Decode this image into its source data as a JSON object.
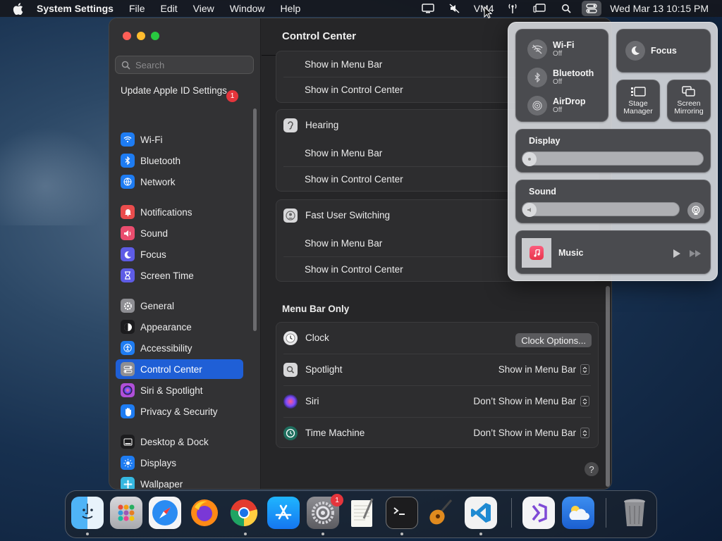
{
  "menubar": {
    "app_name": "System Settings",
    "menus": [
      "File",
      "Edit",
      "View",
      "Window",
      "Help"
    ],
    "status_text": "VM4",
    "clock": "Wed Mar 13  10:15 PM"
  },
  "window": {
    "sidebar": {
      "search_placeholder": "Search",
      "apple_id": "Update Apple ID Settings",
      "apple_id_badge": "1",
      "items": [
        {
          "label": "Wi-Fi",
          "icon": "wifi-icon",
          "color": "#1e7cf2"
        },
        {
          "label": "Bluetooth",
          "icon": "bluetooth-icon",
          "color": "#1e7cf2"
        },
        {
          "label": "Network",
          "icon": "globe-icon",
          "color": "#1e7cf2"
        },
        {
          "label": "Notifications",
          "icon": "bell-icon",
          "color": "#ea4d4d"
        },
        {
          "label": "Sound",
          "icon": "speaker-icon",
          "color": "#ea4d6e"
        },
        {
          "label": "Focus",
          "icon": "moon-icon",
          "color": "#5e5ce6"
        },
        {
          "label": "Screen Time",
          "icon": "hourglass-icon",
          "color": "#5e5ce6"
        },
        {
          "label": "General",
          "icon": "gear-icon",
          "color": "#8e8e93"
        },
        {
          "label": "Appearance",
          "icon": "appearance-icon",
          "color": "#1c1c1e"
        },
        {
          "label": "Accessibility",
          "icon": "accessibility-icon",
          "color": "#1e7cf2"
        },
        {
          "label": "Control Center",
          "icon": "control-center-icon",
          "color": "#8e8e93"
        },
        {
          "label": "Siri & Spotlight",
          "icon": "siri-icon",
          "color": "#b04fd8"
        },
        {
          "label": "Privacy & Security",
          "icon": "hand-icon",
          "color": "#1e7cf2"
        },
        {
          "label": "Desktop & Dock",
          "icon": "dock-icon",
          "color": "#1c1c1e"
        },
        {
          "label": "Displays",
          "icon": "sun-icon",
          "color": "#1e7cf2"
        },
        {
          "label": "Wallpaper",
          "icon": "wallpaper-icon",
          "color": "#35b8e0"
        }
      ],
      "active_item": "Control Center"
    },
    "content": {
      "title": "Control Center",
      "top_group": {
        "rows": [
          "Show in Menu Bar",
          "Show in Control Center"
        ]
      },
      "hearing": {
        "label": "Hearing",
        "rows": [
          "Show in Menu Bar",
          "Show in Control Center"
        ]
      },
      "fast_user_switching": {
        "label": "Fast User Switching",
        "rows": [
          "Show in Menu Bar",
          "Show in Control Center"
        ]
      },
      "menu_bar_only": {
        "title": "Menu Bar Only",
        "rows": [
          {
            "label": "Clock",
            "control": "button",
            "value": "Clock Options..."
          },
          {
            "label": "Spotlight",
            "control": "popup",
            "value": "Show in Menu Bar"
          },
          {
            "label": "Siri",
            "control": "popup",
            "value": "Don’t Show in Menu Bar"
          },
          {
            "label": "Time Machine",
            "control": "popup",
            "value": "Don’t Show in Menu Bar"
          }
        ]
      },
      "help": "?"
    }
  },
  "control_center_panel": {
    "wifi": {
      "title": "Wi-Fi",
      "status": "Off"
    },
    "bluetooth": {
      "title": "Bluetooth",
      "status": "Off"
    },
    "airdrop": {
      "title": "AirDrop",
      "status": "Off"
    },
    "focus": "Focus",
    "stage_manager": "Stage\nManager",
    "screen_mirroring": "Screen\nMirroring",
    "display_label": "Display",
    "display_level": 0.0,
    "sound_label": "Sound",
    "sound_level": 0.0,
    "music": "Music"
  },
  "dock": {
    "apps": [
      "Finder",
      "Launchpad",
      "Safari",
      "Firefox",
      "Google Chrome",
      "App Store",
      "System Settings",
      "TextEdit",
      "Terminal",
      "GarageBand",
      "Visual Studio Code",
      "Visual Studio",
      "Weather",
      "Trash"
    ],
    "settings_badge": "1"
  }
}
